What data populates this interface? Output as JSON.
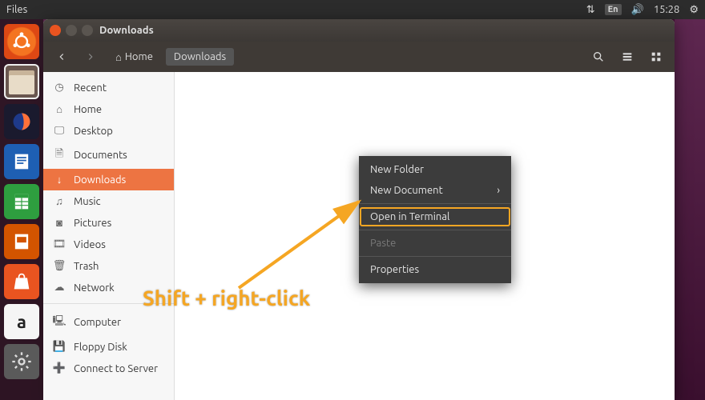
{
  "top_panel": {
    "app_name": "Files",
    "lang": "En",
    "time": "15:28"
  },
  "window": {
    "title": "Downloads",
    "path": {
      "home": "Home",
      "current": "Downloads"
    }
  },
  "sidebar": {
    "items": [
      {
        "icon": "clock-icon",
        "glyph": "◷",
        "label": "Recent"
      },
      {
        "icon": "home-icon",
        "glyph": "⌂",
        "label": "Home"
      },
      {
        "icon": "desktop-icon",
        "glyph": "🖵",
        "label": "Desktop"
      },
      {
        "icon": "documents-icon",
        "glyph": "🗎",
        "label": "Documents"
      },
      {
        "icon": "downloads-icon",
        "glyph": "↓",
        "label": "Downloads",
        "active": true
      },
      {
        "icon": "music-icon",
        "glyph": "♫",
        "label": "Music"
      },
      {
        "icon": "pictures-icon",
        "glyph": "◙",
        "label": "Pictures"
      },
      {
        "icon": "videos-icon",
        "glyph": "🎞",
        "label": "Videos"
      },
      {
        "icon": "trash-icon",
        "glyph": "🗑",
        "label": "Trash"
      },
      {
        "icon": "network-icon",
        "glyph": "☁",
        "label": "Network"
      }
    ],
    "devices": [
      {
        "icon": "computer-icon",
        "glyph": "🖳",
        "label": "Computer"
      },
      {
        "icon": "floppy-icon",
        "glyph": "💾",
        "label": "Floppy Disk"
      },
      {
        "icon": "connect-icon",
        "glyph": "➕",
        "label": "Connect to Server"
      }
    ]
  },
  "context_menu": {
    "new_folder": "New Folder",
    "new_document": "New Document",
    "open_terminal": "Open in Terminal",
    "paste": "Paste",
    "properties": "Properties"
  },
  "annotation": {
    "text": "Shift + right-click"
  }
}
